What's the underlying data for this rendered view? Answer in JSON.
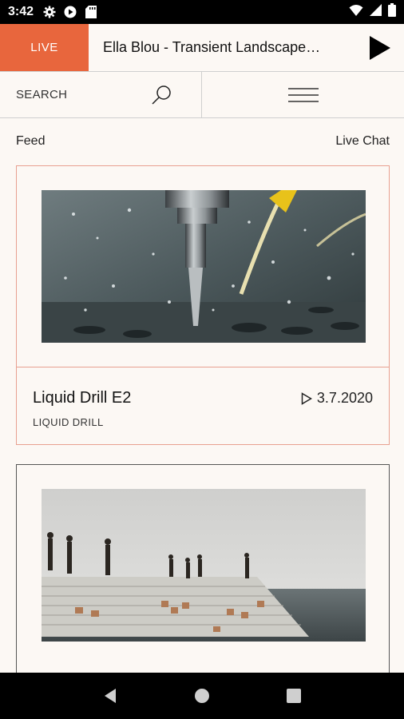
{
  "status_bar": {
    "time": "3:42",
    "icons": [
      "gear-icon",
      "play-circle-icon",
      "sd-card-icon",
      "wifi-icon",
      "cell-signal-icon",
      "battery-icon"
    ]
  },
  "player": {
    "live_label": "LIVE",
    "now_playing": "Ella Blou - Transient Landscape…",
    "accent_color": "#e8663d"
  },
  "search": {
    "label": "SEARCH"
  },
  "tabs": {
    "feed": "Feed",
    "live_chat": "Live Chat"
  },
  "feed": {
    "items": [
      {
        "title": "Liquid Drill E2",
        "subtitle": "LIQUID DRILL",
        "date": "3.7.2020",
        "image": "drill with liquid splash (watermark: alamy)"
      },
      {
        "title": "",
        "subtitle": "",
        "date": "",
        "image": "people on seaside stone steps"
      }
    ]
  },
  "navigation": {
    "icons": [
      "back-icon",
      "home-icon",
      "recents-icon"
    ]
  }
}
